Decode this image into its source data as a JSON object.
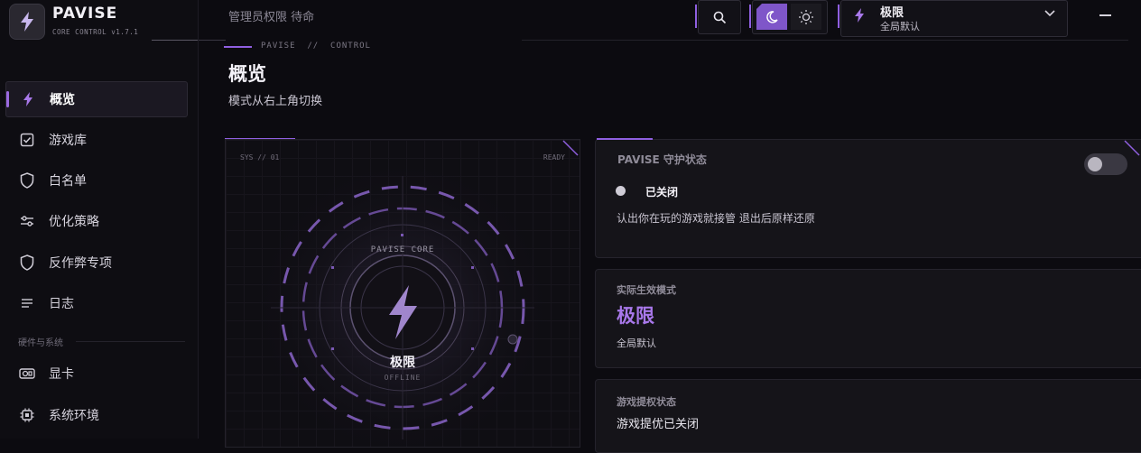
{
  "app": {
    "title": "PAVISE",
    "subtitle": "CORE CONTROL v1.7.1"
  },
  "sidebar": {
    "items": [
      {
        "label": "概览",
        "icon": "bolt-icon",
        "active": true
      },
      {
        "label": "游戏库",
        "icon": "checkbox-icon"
      },
      {
        "label": "白名单",
        "icon": "shield-icon"
      },
      {
        "label": "优化策略",
        "icon": "sliders-icon"
      },
      {
        "label": "反作弊专项",
        "icon": "shield-icon"
      },
      {
        "label": "日志",
        "icon": "list-icon"
      }
    ],
    "section_label": "硬件与系统",
    "hardware_items": [
      {
        "label": "显卡",
        "icon": "gpu-icon"
      },
      {
        "label": "系统环境",
        "icon": "chip-icon"
      }
    ]
  },
  "topbar": {
    "permission_text": "管理员权限 待命",
    "mode": {
      "name": "极限",
      "scope": "全局默认"
    },
    "theme": "dark"
  },
  "header": {
    "breadcrumb": "PAVISE  //  CONTROL",
    "title": "概览",
    "subtitle": "模式从右上角切换"
  },
  "core_panel": {
    "sys_label": "SYS // 01",
    "ready_label": "READY",
    "caption": "PAVISE CORE",
    "mode": "极限",
    "status": "OFFLINE"
  },
  "protection_card": {
    "title": "PAVISE 守护状态",
    "state": "已关闭",
    "description": "认出你在玩的游戏就接管 退出后原样还原",
    "toggle_on": false
  },
  "mode_card": {
    "label": "实际生效模式",
    "value": "极限",
    "scope": "全局默认"
  },
  "game_card": {
    "label": "游戏提权状态",
    "value": "游戏提优已关闭"
  },
  "colors": {
    "accent": "#8f5fe0",
    "accent_text": "#a878ea",
    "background": "#0c0b10"
  }
}
